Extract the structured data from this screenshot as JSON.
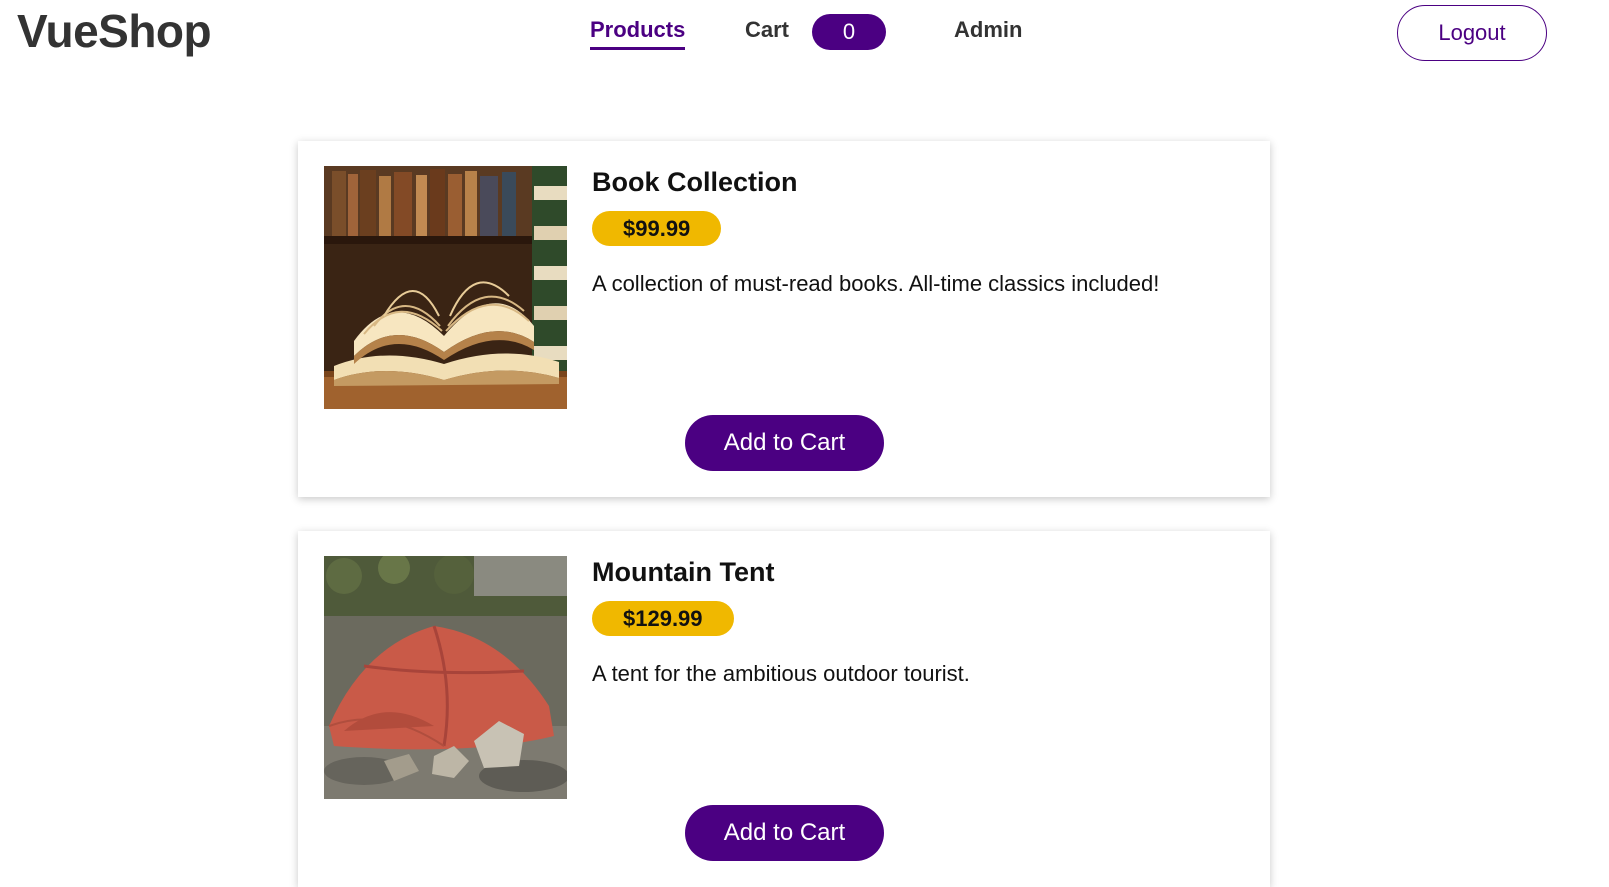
{
  "header": {
    "brand": "VueShop",
    "nav": {
      "products": "Products",
      "cart": "Cart",
      "cart_count": "0",
      "admin": "Admin"
    },
    "logout": "Logout"
  },
  "products": [
    {
      "title": "Book Collection",
      "price": "$99.99",
      "description": "A collection of must-read books. All-time classics included!",
      "button": "Add to Cart"
    },
    {
      "title": "Mountain Tent",
      "price": "$129.99",
      "description": "A tent for the ambitious outdoor tourist.",
      "button": "Add to Cart"
    }
  ],
  "colors": {
    "accent": "#4b0082",
    "price_badge": "#f0b800"
  }
}
